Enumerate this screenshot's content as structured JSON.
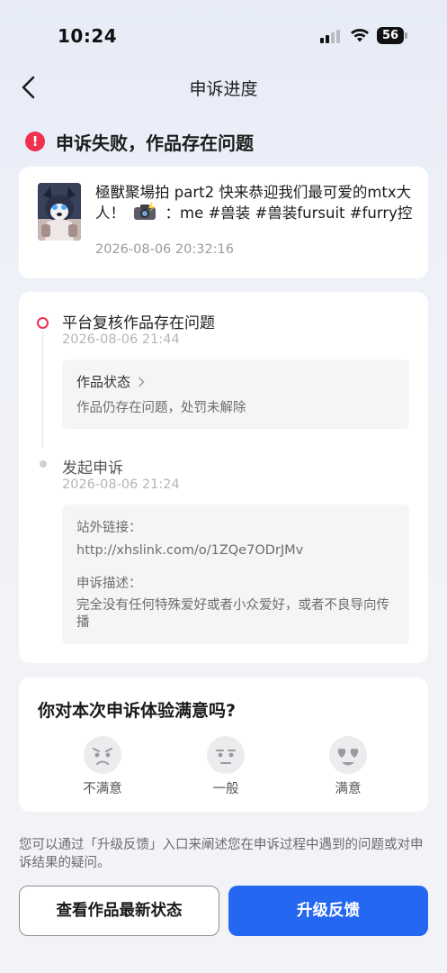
{
  "status_bar": {
    "time": "10:24",
    "battery": "56"
  },
  "nav": {
    "title": "申诉进度"
  },
  "result": {
    "text": "申诉失败，作品存在问题",
    "icon_glyph": "!",
    "color": "#f0304f"
  },
  "work": {
    "title_part1": "極獸聚場拍 part2 快来恭迎我们最可爱的mtx大人！",
    "title_part2": "：me #兽装 #兽装fursuit #furry控",
    "date": "2026-08-06 20:32:16"
  },
  "timeline": {
    "step1": {
      "title": "平台复核作品存在问题",
      "date": "2026-08-06 21:44",
      "state_label": "作品状态",
      "state_desc": "作品仍存在问题，处罚未解除"
    },
    "step2": {
      "title": "发起申诉",
      "date": "2026-08-06 21:24",
      "link_label": "站外链接：",
      "link_value": "http://xhslink.com/o/1ZQe7ODrJMv",
      "desc_label": "申诉描述：",
      "desc_value": "完全没有任何特殊爱好或者小众爱好，或者不良导向传播"
    }
  },
  "survey": {
    "question": "你对本次申诉体验满意吗?",
    "options": [
      {
        "label": "不满意",
        "icon": "unhappy-face-icon"
      },
      {
        "label": "一般",
        "icon": "neutral-face-icon"
      },
      {
        "label": "满意",
        "icon": "heart-eyes-face-icon"
      }
    ]
  },
  "tip": "您可以通过「升级反馈」入口来阐述您在申诉过程中遇到的问题或对申诉结果的疑问。",
  "buttons": {
    "view_status": "查看作品最新状态",
    "escalate": "升级反馈"
  },
  "colors": {
    "primary": "#2468f2",
    "error": "#f0304f"
  }
}
